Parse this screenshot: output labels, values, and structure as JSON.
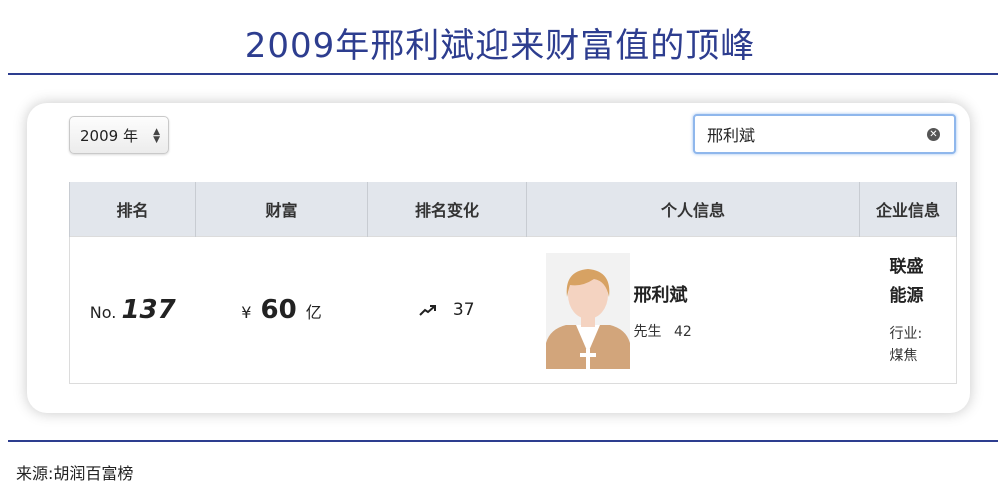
{
  "title": "2009年邢利斌迎来财富值的顶峰",
  "source": "来源:胡润百富榜",
  "controls": {
    "year_value": "2009 年",
    "search_value": "邢利斌"
  },
  "table": {
    "headers": [
      "排名",
      "财富",
      "排名变化",
      "个人信息",
      "企业信息"
    ],
    "row": {
      "rank_prefix": "No.",
      "rank": "137",
      "currency": "¥",
      "wealth": "60",
      "wealth_unit": "亿",
      "rank_change": "37",
      "person_name": "邢利斌",
      "person_title": "先生",
      "person_age": "42",
      "company_line1": "联盛",
      "company_line2": "能源",
      "industry_label": "行业:",
      "industry": "煤焦"
    }
  },
  "colors": {
    "title": "#2d3d8f",
    "rule": "#2d3d8f",
    "header_bg": "#e2e6ec",
    "avatar_bg": "#f2f2f2",
    "avatar_skin": "#f4d3c1",
    "avatar_hair": "#d7a263",
    "avatar_suit": "#d2a57b"
  },
  "icons": {
    "trend": "trend-up-icon",
    "clear": "clear-icon",
    "select_arrows": "select-arrows-icon"
  }
}
